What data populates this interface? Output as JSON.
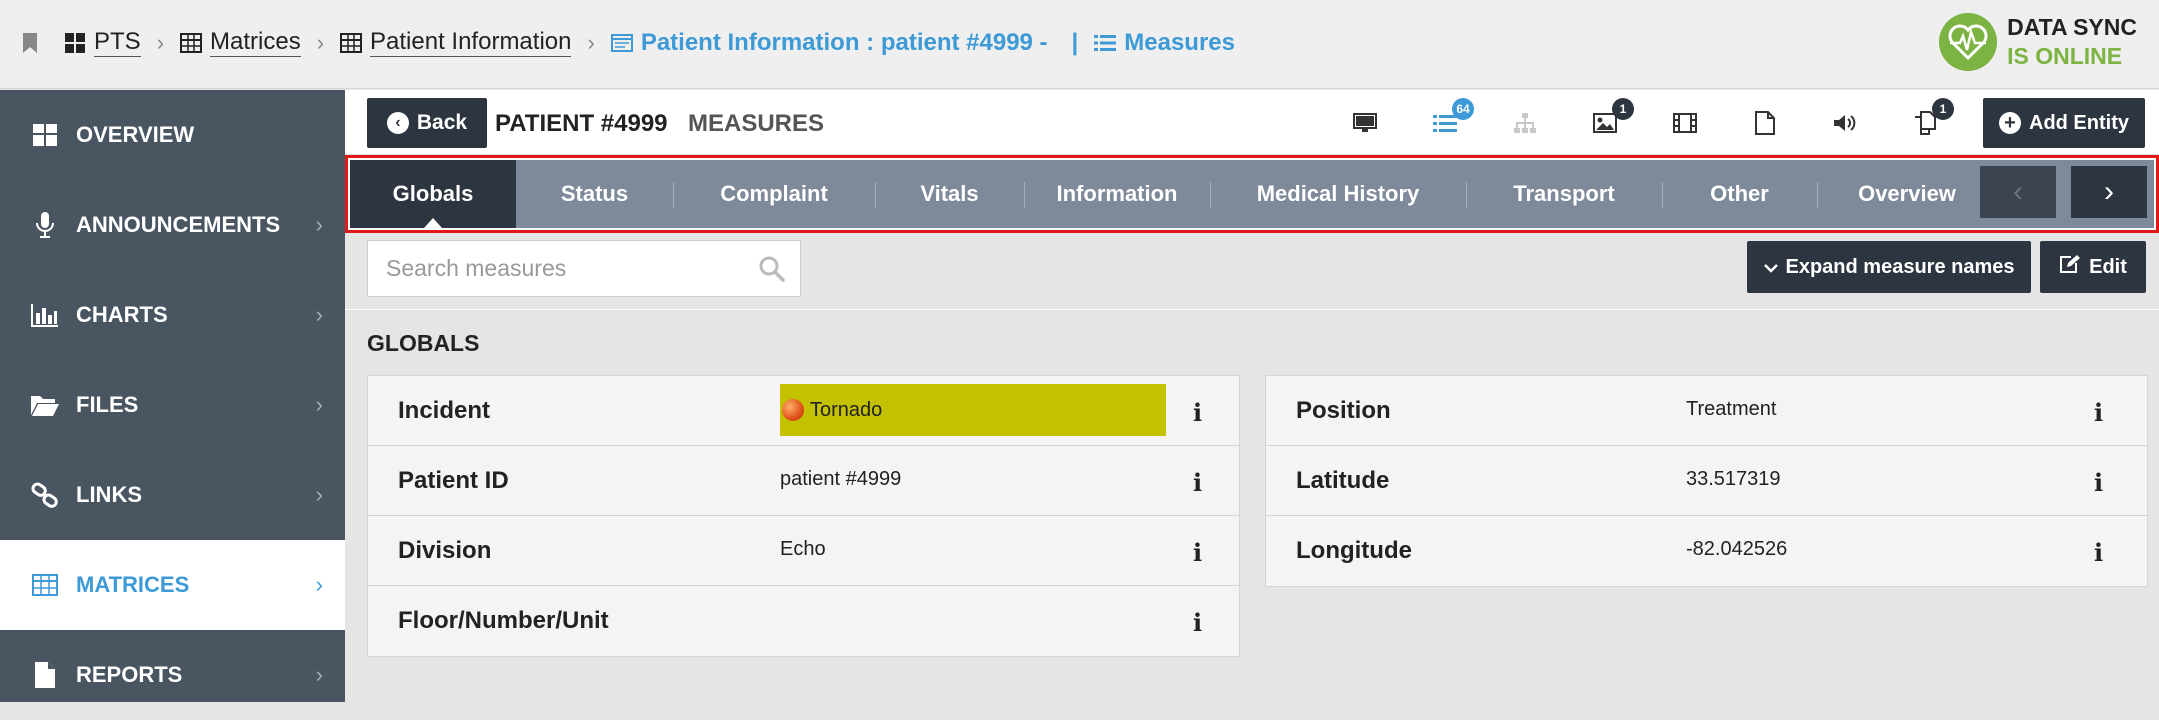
{
  "breadcrumb": {
    "items": [
      {
        "label": "PTS"
      },
      {
        "label": "Matrices"
      },
      {
        "label": "Patient Information"
      },
      {
        "label": "Patient Information : patient #4999  -"
      },
      {
        "label": "Measures"
      }
    ],
    "pipe": "|"
  },
  "sync": {
    "line1": "DATA SYNC",
    "line2": "IS ONLINE"
  },
  "sidebar": {
    "items": [
      {
        "label": "OVERVIEW",
        "icon": "dashboard-icon"
      },
      {
        "label": "ANNOUNCEMENTS",
        "icon": "microphone-icon"
      },
      {
        "label": "CHARTS",
        "icon": "bar-chart-icon"
      },
      {
        "label": "FILES",
        "icon": "folder-open-icon"
      },
      {
        "label": "LINKS",
        "icon": "link-icon"
      },
      {
        "label": "MATRICES",
        "icon": "table-icon"
      },
      {
        "label": "REPORTS",
        "icon": "file-icon"
      }
    ],
    "active": "MATRICES"
  },
  "header": {
    "back_label": "Back",
    "title": "PATIENT #4999",
    "subtitle": "MEASURES",
    "add_entity_label": "Add Entity",
    "toolbar": {
      "list_badge": "64",
      "image_badge": "1",
      "copy_badge": "1"
    }
  },
  "tabs": [
    "Globals",
    "Status",
    "Complaint",
    "Vitals",
    "Information",
    "Medical History",
    "Transport",
    "Other",
    "Overview"
  ],
  "active_tab": "Globals",
  "search": {
    "placeholder": "Search measures"
  },
  "actions": {
    "expand_label": "Expand measure names",
    "edit_label": "Edit"
  },
  "section": {
    "title": "GLOBALS"
  },
  "measures_left": [
    {
      "label": "Incident",
      "value": "Tornado"
    },
    {
      "label": "Patient ID",
      "value": "patient #4999"
    },
    {
      "label": "Division",
      "value": "Echo"
    },
    {
      "label": "Floor/Number/Unit",
      "value": ""
    }
  ],
  "measures_right": [
    {
      "label": "Position",
      "value": "Treatment"
    },
    {
      "label": "Latitude",
      "value": "33.517319"
    },
    {
      "label": "Longitude",
      "value": "-82.042526"
    }
  ],
  "info_glyph": "i",
  "colors": {
    "accent": "#3d9ad6",
    "sidebar": "#4a5562",
    "highlight": "#c3c100",
    "online": "#7cb342"
  }
}
